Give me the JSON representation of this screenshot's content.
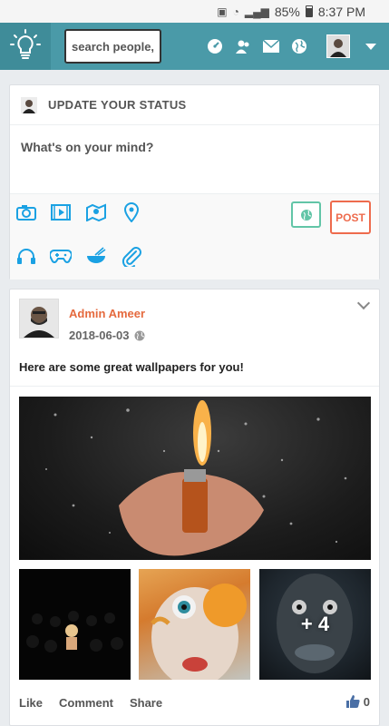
{
  "statusbar": {
    "battery": "85%",
    "time": "8:37 PM"
  },
  "header": {
    "search_placeholder": "search people,",
    "icons": [
      "lightbulb-logo-icon",
      "dashboard-icon",
      "friends-icon",
      "mail-icon",
      "globe-icon",
      "user-avatar",
      "caret-down-icon"
    ]
  },
  "status_card": {
    "title": "UPDATE YOUR STATUS",
    "prompt": "What's on your mind?",
    "tools_row1": [
      "camera-icon",
      "video-icon",
      "map-icon",
      "location-icon"
    ],
    "tools_row2": [
      "headphones-icon",
      "gamepad-icon",
      "food-icon",
      "attachment-icon"
    ],
    "post_label": "POST"
  },
  "post": {
    "author": "Admin Ameer",
    "date": "2018-06-03",
    "text": "Here are some great wallpapers for you!",
    "more_count": "+ 4",
    "actions": {
      "like": "Like",
      "comment": "Comment",
      "share": "Share"
    },
    "like_count": "0"
  },
  "colors": {
    "header": "#4a9aa8",
    "accent_orange": "#ee6b4d",
    "accent_green": "#62c5a7",
    "icon_blue": "#1aa1e3"
  }
}
